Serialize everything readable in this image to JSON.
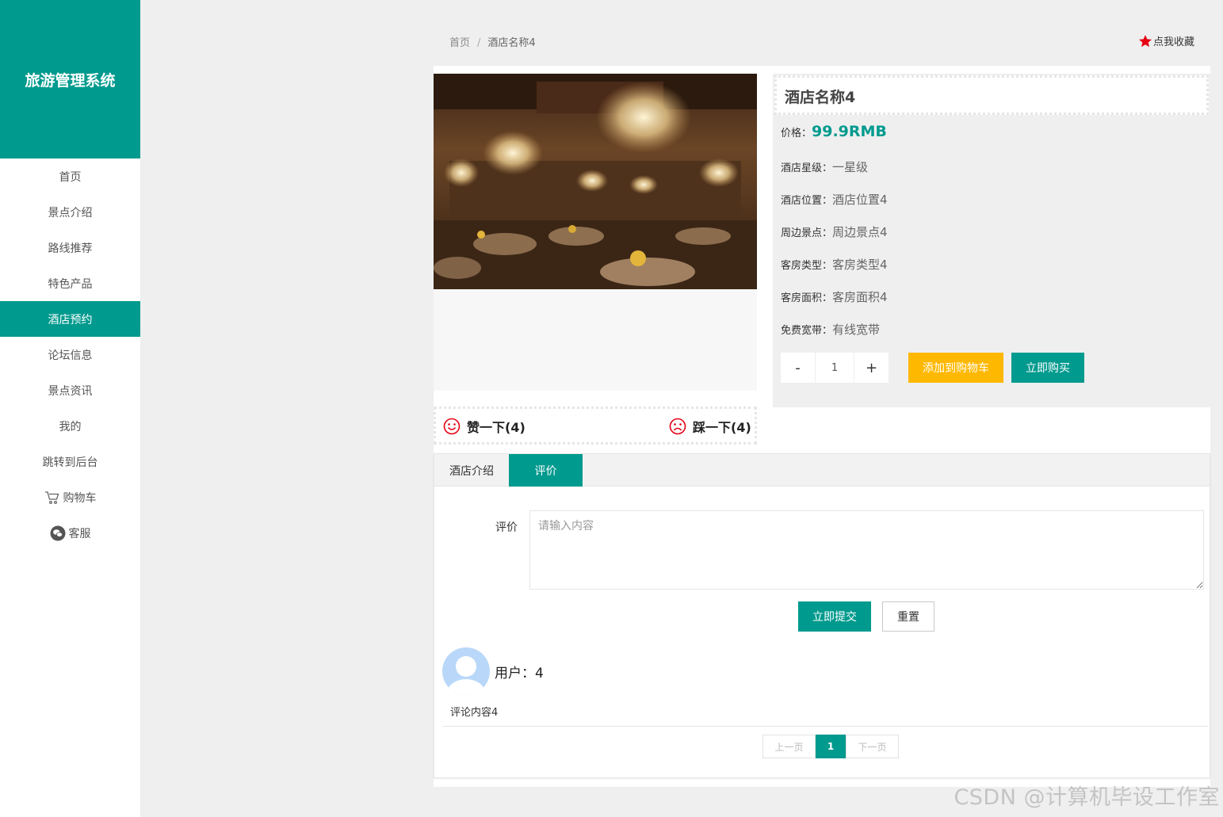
{
  "app": {
    "title": "旅游管理系统",
    "brand_color": "#009a8e"
  },
  "sidebar": {
    "items": [
      {
        "label": "首页"
      },
      {
        "label": "景点介绍"
      },
      {
        "label": "路线推荐"
      },
      {
        "label": "特色产品"
      },
      {
        "label": "酒店预约",
        "active": true
      },
      {
        "label": "论坛信息"
      },
      {
        "label": "景点资讯"
      },
      {
        "label": "我的"
      },
      {
        "label": "跳转到后台"
      },
      {
        "label": "购物车",
        "icon": "cart-icon"
      },
      {
        "label": "客服",
        "icon": "wechat-icon"
      }
    ]
  },
  "breadcrumb": {
    "home": "首页",
    "separator": "/",
    "current": "酒店名称4"
  },
  "favorite": {
    "label": "点我收藏",
    "icon": "star-icon"
  },
  "hotel": {
    "name": "酒店名称4",
    "price_label": "价格：",
    "price": "99.9RMB",
    "attributes": [
      {
        "label": "酒店星级：",
        "value": "一星级"
      },
      {
        "label": "酒店位置：",
        "value": "酒店位置4"
      },
      {
        "label": "周边景点：",
        "value": "周边景点4"
      },
      {
        "label": "客房类型：",
        "value": "客房类型4"
      },
      {
        "label": "客房面积：",
        "value": "客房面积4"
      },
      {
        "label": "免费宽带：",
        "value": "有线宽带"
      }
    ]
  },
  "quantity": {
    "minus": "-",
    "value": "1",
    "plus": "+"
  },
  "actions": {
    "add_to_cart": "添加到购物车",
    "buy_now": "立即购买"
  },
  "votes": {
    "like": "赞一下(4)",
    "dislike": "踩一下(4)"
  },
  "tabs": [
    {
      "label": "酒店介绍"
    },
    {
      "label": "评价",
      "active": true
    }
  ],
  "review_form": {
    "label": "评价",
    "placeholder": "请输入内容",
    "submit": "立即提交",
    "reset": "重置"
  },
  "comments": [
    {
      "user": "用户：4",
      "content": "评论内容4"
    }
  ],
  "pagination": {
    "prev": "上一页",
    "current": "1",
    "next": "下一页"
  },
  "watermark": "CSDN @计算机毕设工作室"
}
